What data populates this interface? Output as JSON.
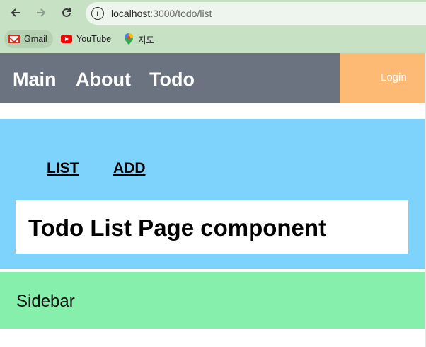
{
  "browser": {
    "url_host": "localhost",
    "url_path": ":3000/todo/list",
    "bookmarks": [
      {
        "label": "Gmail",
        "icon": "gmail-icon"
      },
      {
        "label": "YouTube",
        "icon": "youtube-icon"
      },
      {
        "label": "지도",
        "icon": "maps-icon"
      }
    ]
  },
  "header": {
    "nav": [
      {
        "label": "Main"
      },
      {
        "label": "About"
      },
      {
        "label": "Todo"
      }
    ],
    "login_label": "Login"
  },
  "content": {
    "sub_nav": [
      {
        "label": "LIST"
      },
      {
        "label": "ADD"
      }
    ],
    "title": "Todo List Page component"
  },
  "sidebar": {
    "label": "Sidebar"
  },
  "colors": {
    "header_bg": "#6b7280",
    "login_bg": "#fdba74",
    "content_bg": "#7dd3fc",
    "sidebar_bg": "#86efac"
  }
}
